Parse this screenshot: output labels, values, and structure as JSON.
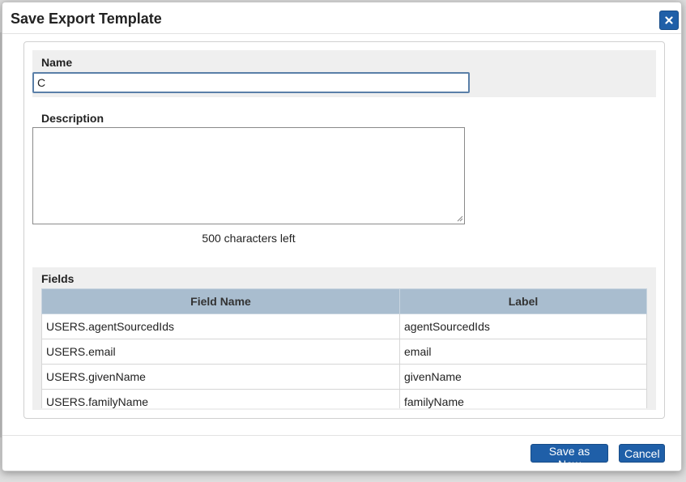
{
  "dialog": {
    "title": "Save Export Template",
    "close_icon": "close-icon"
  },
  "form": {
    "name_label": "Name",
    "name_value": "C",
    "description_label": "Description",
    "description_value": "",
    "char_count": "500 characters left",
    "fields_label": "Fields"
  },
  "fields_table": {
    "columns": [
      "Field Name",
      "Label"
    ],
    "rows": [
      {
        "field_name": "USERS.agentSourcedIds",
        "label": "agentSourcedIds"
      },
      {
        "field_name": "USERS.email",
        "label": "email"
      },
      {
        "field_name": "USERS.givenName",
        "label": "givenName"
      },
      {
        "field_name": "USERS.familyName",
        "label": "familyName"
      }
    ]
  },
  "footer": {
    "save_label": "Save as New",
    "cancel_label": "Cancel"
  },
  "colors": {
    "button_blue": "#1f5fa8",
    "table_header": "#a9bdcf",
    "section_gray": "#efefef"
  }
}
